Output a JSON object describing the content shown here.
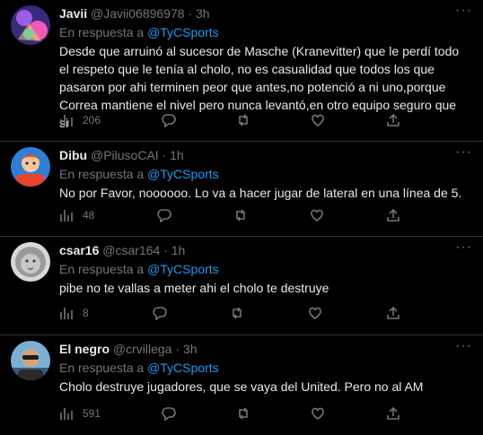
{
  "tweets": [
    {
      "name": "Javii",
      "handle": "@Javii06896978",
      "time": "3h",
      "reply_prefix": "En respuesta a",
      "reply_to": "@TyCSports",
      "text": "Desde que arruinó al sucesor de Masche (Kranevitter) que le perdí todo el respeto que le tenía al cholo, no es casualidad que todos los que pasaron por ahi terminen peor que antes,no potenció a ni uno,porque Correa mantiene el nivel pero nunca levantó,en otro equipo seguro que si",
      "views": "206"
    },
    {
      "name": "Dibu",
      "handle": "@PilusoCAI",
      "time": "1h",
      "reply_prefix": "En respuesta a",
      "reply_to": "@TyCSports",
      "text": "No por Favor,  noooooo. Lo va a hacer jugar de lateral en una línea de 5.",
      "views": "48"
    },
    {
      "name": "csar16",
      "handle": "@csar164",
      "time": "1h",
      "reply_prefix": "En respuesta a",
      "reply_to": "@TyCSports",
      "text": "pibe no te vallas a meter ahi el cholo te destruye",
      "views": "8"
    },
    {
      "name": "El negro",
      "handle": "@crvillega",
      "time": "3h",
      "reply_prefix": "En respuesta a",
      "reply_to": "@TyCSports",
      "text": "Cholo destruye jugadores, que se vaya del United. Pero no al AM",
      "views": "591"
    }
  ],
  "dot": "·",
  "more_glyph": "···",
  "icons": {
    "reply": "reply-icon",
    "retweet": "retweet-icon",
    "like": "like-icon",
    "share": "share-icon",
    "views": "views-icon",
    "more": "more-icon"
  },
  "colors": {
    "background": "#000000",
    "text": "#e7e9ea",
    "secondary": "#71767b",
    "accent": "#1d9bf0",
    "divider": "#2f3336"
  }
}
